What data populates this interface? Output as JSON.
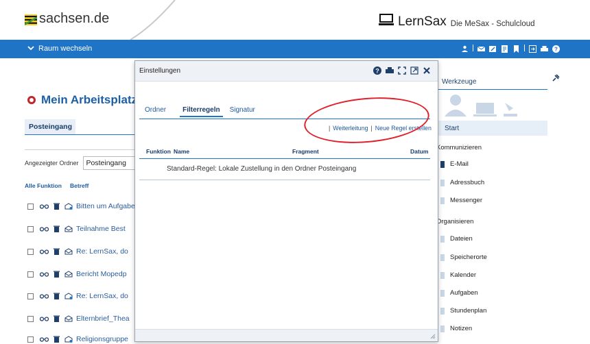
{
  "header": {
    "site": "sachsen.de",
    "brand": "LernSax",
    "brand_tagline": "Die MeSax - Schulcloud"
  },
  "bluebar": {
    "room_switch": "Raum wechseln"
  },
  "workplace": {
    "title": "Mein Arbeitsplatz",
    "inbox_tab": "Posteingang",
    "folder_label": "Angezeigter Ordner",
    "folder_value": "Posteingang",
    "list_headers": {
      "all": "Alle",
      "function": "Funktion",
      "subject": "Betreff"
    },
    "mails": [
      {
        "subject": "Bitten um Aufgaben"
      },
      {
        "subject": "Teilnahme Best"
      },
      {
        "subject": "Re: LernSax, do"
      },
      {
        "subject": "Bericht Mopedp"
      },
      {
        "subject": "Re: LernSax, do"
      },
      {
        "subject": "Elternbrief_Thea"
      },
      {
        "subject": "Religionsgruppe"
      }
    ]
  },
  "tools_panel": {
    "title": "Werkzeuge",
    "start": "Start",
    "section_communicate": "Kommunizieren",
    "communicate_items": [
      "E-Mail",
      "Adressbuch",
      "Messenger"
    ],
    "section_organize": "Organisieren",
    "organize_items": [
      "Dateien",
      "Speicherorte",
      "Kalender",
      "Aufgaben",
      "Stundenplan",
      "Notizen"
    ]
  },
  "modal": {
    "title": "Einstellungen",
    "tabs": [
      "Ordner",
      "Filterregeln",
      "Signatur"
    ],
    "active_tab": "Filterregeln",
    "links": [
      "Weiterleitung",
      "Neue Regel erstellen"
    ],
    "table": {
      "headers": {
        "function": "Funktion",
        "name": "Name",
        "fragment": "Fragment",
        "date": "Datum"
      },
      "rows": [
        {
          "name": "Standard-Regel: Lokale Zustellung in den Ordner Posteingang"
        }
      ]
    }
  },
  "colors": {
    "blue_bar": "#1f74c6",
    "title_blue": "#1b5fa8",
    "highlight_red": "#e0202a"
  }
}
